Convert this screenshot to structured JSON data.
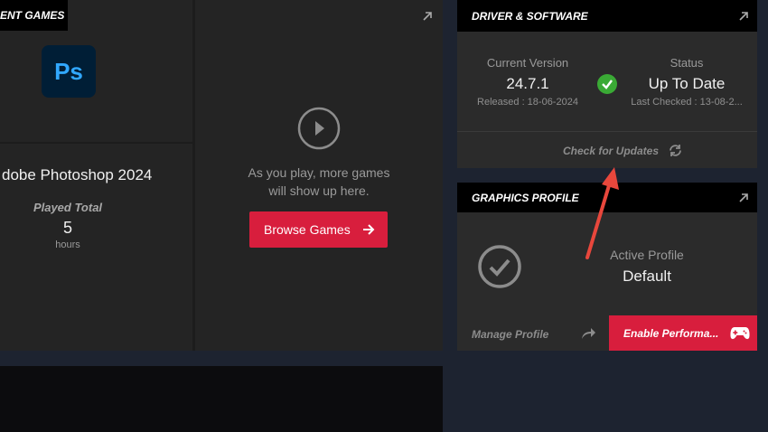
{
  "recent_games": {
    "header": "ENT GAMES",
    "game_title": "dobe Photoshop 2024",
    "game_icon_text": "Ps",
    "played_label": "Played Total",
    "played_value": "5",
    "played_unit": "hours",
    "empty_message_line1": "As you play, more games",
    "empty_message_line2": "will show up here.",
    "browse_button": "Browse Games"
  },
  "driver": {
    "header": "DRIVER & SOFTWARE",
    "current_version_label": "Current Version",
    "version": "24.7.1",
    "released": "Released : 18-06-2024",
    "status_label": "Status",
    "status_value": "Up To Date",
    "last_checked": "Last Checked : 13-08-2...",
    "check_updates": "Check for Updates"
  },
  "graphics_profile": {
    "header": "GRAPHICS PROFILE",
    "active_label": "Active Profile",
    "active_value": "Default",
    "manage_profile": "Manage Profile",
    "enable_button": "Enable Performa..."
  },
  "colors": {
    "accent": "#d81e3d",
    "status_ok": "#3aaa35",
    "annotation_arrow": "#e8473c"
  }
}
